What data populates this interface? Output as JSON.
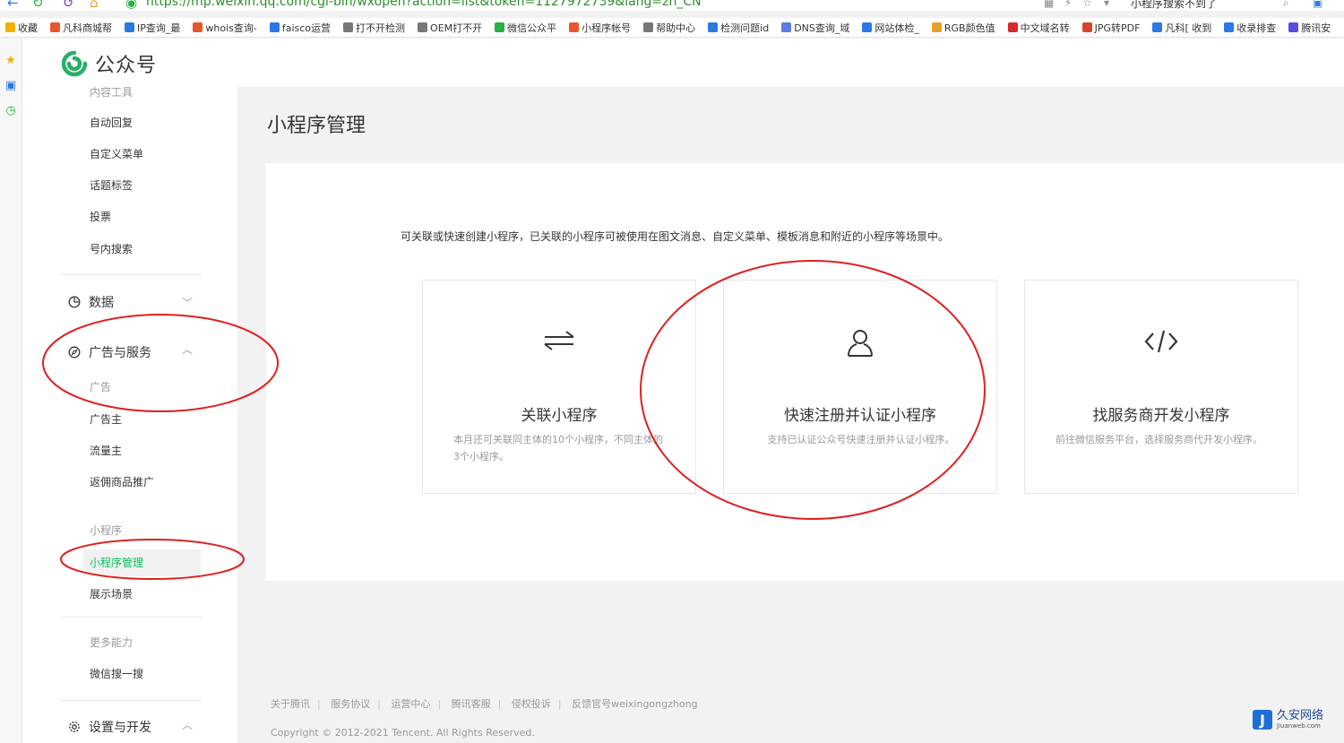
{
  "browser": {
    "url": "https://mp.weixin.qq.com/cgi-bin/wxopen?action=list&token=1127972739&lang=zh_CN",
    "tab_title": "小程序搜索不到了",
    "bookmarks": [
      {
        "label": "收藏",
        "color": "#f0b400"
      },
      {
        "label": "凡科商城帮",
        "color": "#e8552b"
      },
      {
        "label": "IP查询_最",
        "color": "#2a7ae2"
      },
      {
        "label": "whois查询-",
        "color": "#e8552b"
      },
      {
        "label": "faisco运营",
        "color": "#2a7ae2"
      },
      {
        "label": "打不开检测",
        "color": "#777777"
      },
      {
        "label": "OEM打不开",
        "color": "#777777"
      },
      {
        "label": "微信公众平",
        "color": "#2aae47"
      },
      {
        "label": "小程序帐号",
        "color": "#e8552b"
      },
      {
        "label": "帮助中心",
        "color": "#777777"
      },
      {
        "label": "检测问题id",
        "color": "#2a7ae2"
      },
      {
        "label": "DNS查询_域",
        "color": "#5b7be0"
      },
      {
        "label": "网站体检_",
        "color": "#2a7ae2"
      },
      {
        "label": "RGB颜色值",
        "color": "#e8a02b"
      },
      {
        "label": "中文域名转",
        "color": "#d62b2b"
      },
      {
        "label": "JPG转PDF",
        "color": "#d6452b"
      },
      {
        "label": "凡科[ 收到",
        "color": "#2a7ae2"
      },
      {
        "label": "收录排查",
        "color": "#2a7ae2"
      },
      {
        "label": "腾讯安",
        "color": "#5b4be0"
      }
    ]
  },
  "header": {
    "logo_text": "公众号"
  },
  "menu": {
    "top_partial": "内容工具",
    "content_items": [
      "自动回复",
      "自定义菜单",
      "话题标签",
      "投票",
      "号内搜索"
    ],
    "group_data": "数据",
    "group_ads": "广告与服务",
    "sub_ads": "广告",
    "ads_items": [
      "广告主",
      "流量主",
      "返佣商品推广"
    ],
    "sub_miniprogram": "小程序",
    "miniprogram_items": [
      "小程序管理",
      "展示场景"
    ],
    "sub_more": "更多能力",
    "more_items": [
      "微信搜一搜"
    ],
    "group_settings": "设置与开发"
  },
  "main": {
    "title": "小程序管理",
    "intro": "可关联或快速创建小程序，已关联的小程序可被使用在图文消息、自定义菜单、模板消息和附近的小程序等场景中。",
    "cards": [
      {
        "icon": "swap-icon",
        "title": "关联小程序",
        "desc": "本月还可关联同主体的10个小程序，不同主体的3个小程序。"
      },
      {
        "icon": "user-icon",
        "title": "快速注册并认证小程序",
        "desc": "支持已认证公众号快速注册并认证小程序。"
      },
      {
        "icon": "code-icon",
        "title": "找服务商开发小程序",
        "desc": "前往微信服务平台，选择服务商代开发小程序。"
      }
    ]
  },
  "footer": {
    "links": [
      "关于腾讯",
      "服务协议",
      "运营中心",
      "腾讯客服",
      "侵权投诉",
      "反馈官号weixingongzhong"
    ],
    "copyright": "Copyright © 2012-2021 Tencent. All Rights Reserved."
  },
  "watermark": {
    "cn": "久安网络",
    "en": "Jiuanweb.com",
    "mark": "J"
  },
  "colors": {
    "accent": "#07c160",
    "annotation": "#e02020",
    "logo": "#2aae67"
  }
}
